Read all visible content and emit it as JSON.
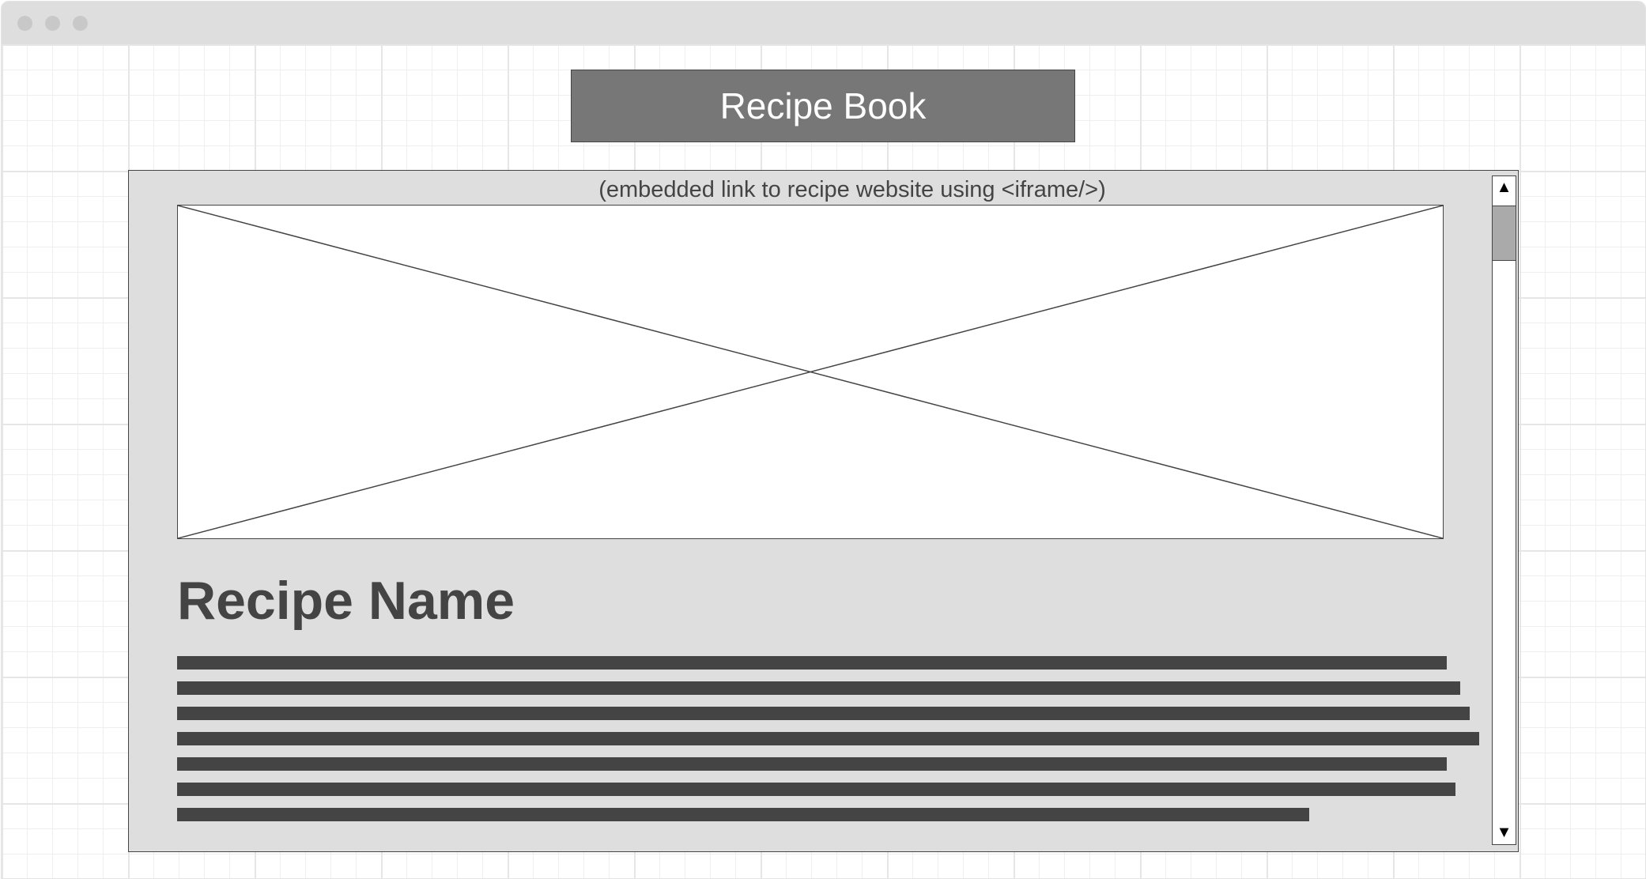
{
  "header": {
    "title": "Recipe Book"
  },
  "panel": {
    "caption": "(embedded link to recipe website using <iframe/>)",
    "recipe_name": "Recipe Name",
    "text_line_count": 7
  },
  "scrollbar": {
    "up_icon": "▲",
    "down_icon": "▼",
    "position": 0
  }
}
